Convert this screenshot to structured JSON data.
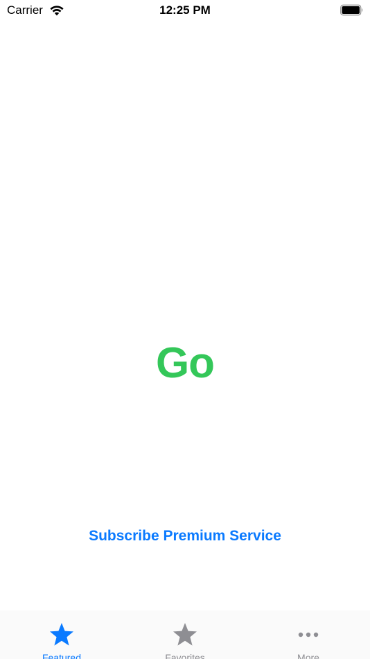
{
  "status_bar": {
    "carrier": "Carrier",
    "time": "12:25 PM"
  },
  "main": {
    "go_label": "Go",
    "subscribe_label": "Subscribe Premium Service"
  },
  "tab_bar": {
    "tabs": [
      {
        "label": "Featured",
        "icon": "star-icon",
        "selected": true
      },
      {
        "label": "Favorites",
        "icon": "star-icon",
        "selected": false
      },
      {
        "label": "More",
        "icon": "more-icon",
        "selected": false
      }
    ]
  },
  "colors": {
    "go_green": "#34c759",
    "accent_blue": "#0a7aff",
    "inactive_gray": "#8e8e93"
  }
}
